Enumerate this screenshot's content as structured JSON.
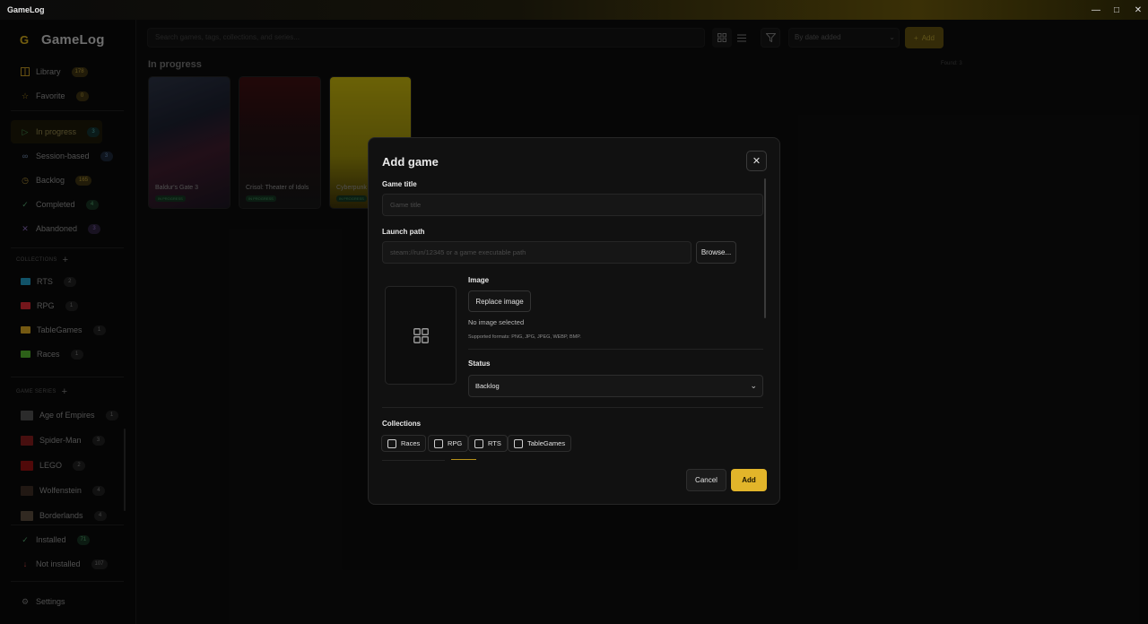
{
  "window": {
    "title": "GameLog"
  },
  "sidebar": {
    "app_name": "GameLog",
    "main_items": [
      {
        "label": "Library",
        "count": "178",
        "icon": "library-icon"
      },
      {
        "label": "Favorite",
        "count": "0",
        "icon": "star-icon"
      }
    ],
    "status_items": [
      {
        "label": "In progress",
        "count": "3",
        "icon": "play-icon",
        "active": true
      },
      {
        "label": "Session-based",
        "count": "3",
        "icon": "infinity-icon"
      },
      {
        "label": "Backlog",
        "count": "165",
        "icon": "clock-icon"
      },
      {
        "label": "Completed",
        "count": "4",
        "icon": "check-icon"
      },
      {
        "label": "Abandoned",
        "count": "3",
        "icon": "x-icon"
      }
    ],
    "collections_label": "COLLECTIONS",
    "collections": [
      {
        "label": "RTS",
        "count": "2",
        "color": "#1e8fb5"
      },
      {
        "label": "RPG",
        "count": "1",
        "color": "#c8262f"
      },
      {
        "label": "TableGames",
        "count": "1",
        "color": "#c99a1f"
      },
      {
        "label": "Races",
        "count": "1",
        "color": "#4da52a"
      }
    ],
    "series_label": "GAME SERIES",
    "series": [
      {
        "label": "Age of Empires",
        "count": "1"
      },
      {
        "label": "Spider-Man",
        "count": "3"
      },
      {
        "label": "LEGO",
        "count": "2"
      },
      {
        "label": "Wolfenstein",
        "count": "4"
      },
      {
        "label": "Borderlands",
        "count": "4"
      }
    ],
    "install_items": [
      {
        "label": "Installed",
        "count": "71"
      },
      {
        "label": "Not installed",
        "count": "107"
      }
    ],
    "settings_label": "Settings"
  },
  "toolbar": {
    "search_placeholder": "Search games, tags, collections, and series...",
    "sort_value": "By date added",
    "add_label": "Add"
  },
  "main": {
    "section_title": "In progress",
    "found_text": "Found: 3",
    "cards": [
      {
        "title": "Baldur's Gate 3",
        "status": "IN PROGRESS"
      },
      {
        "title": "Crisol: Theater of Idols",
        "status": "IN PROGRESS"
      },
      {
        "title": "Cyberpunk",
        "status": "IN PROGRESS"
      }
    ]
  },
  "modal": {
    "title": "Add game",
    "game_title_label": "Game title",
    "game_title_placeholder": "Game title",
    "launch_path_label": "Launch path",
    "launch_path_placeholder": "steam://run/12345 or a game executable path",
    "browse_label": "Browse...",
    "image_label": "Image",
    "replace_image_label": "Replace image",
    "no_image_text": "No image selected",
    "supported_formats": "Supported formats: PNG, JPG, JPEG, WEBP, BMP.",
    "status_label": "Status",
    "status_value": "Backlog",
    "collections_label": "Collections",
    "collection_chips": [
      "Races",
      "RPG",
      "RTS",
      "TableGames"
    ],
    "cancel_label": "Cancel",
    "add_label": "Add"
  }
}
